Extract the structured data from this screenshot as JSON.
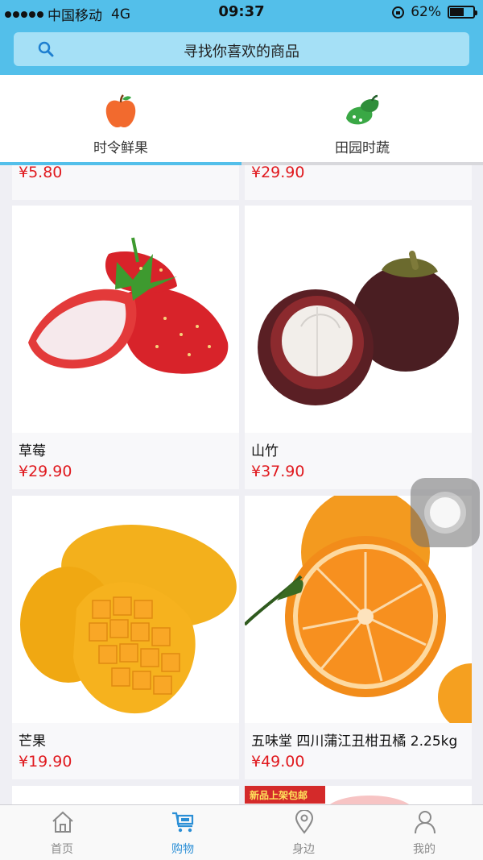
{
  "status_bar": {
    "carrier": "中国移动",
    "network": "4G",
    "time": "09:37",
    "battery": "62%",
    "battery_level": 0.62
  },
  "search": {
    "placeholder": "寻找你喜欢的商品",
    "icon": "search-icon"
  },
  "categories": [
    {
      "label": "时令鲜果",
      "icon": "apple-icon",
      "active": true
    },
    {
      "label": "田园时蔬",
      "icon": "vegetable-icon",
      "active": false
    }
  ],
  "products": [
    {
      "name": "",
      "price": "¥5.80"
    },
    {
      "name": "",
      "price": "¥29.90"
    },
    {
      "name": "草莓",
      "price": "¥29.90",
      "image": "strawberry"
    },
    {
      "name": "山竹",
      "price": "¥37.90",
      "image": "mangosteen"
    },
    {
      "name": "芒果",
      "price": "¥19.90",
      "image": "mango"
    },
    {
      "name": "五味堂  四川蒲江丑柑丑橘 2.25kg",
      "price": "¥49.00",
      "image": "orange"
    },
    {
      "name": "",
      "price": "",
      "image": "blank"
    },
    {
      "name": "",
      "price": "",
      "image": "peach",
      "badge": "新品上架包邮"
    }
  ],
  "bottom_nav": [
    {
      "label": "首页",
      "icon": "home-icon",
      "active": false
    },
    {
      "label": "购物",
      "icon": "cart-icon",
      "active": true
    },
    {
      "label": "身边",
      "icon": "location-pin-icon",
      "active": false
    },
    {
      "label": "我的",
      "icon": "user-icon",
      "active": false
    }
  ],
  "colors": {
    "header": "#53bfea",
    "search_bg": "#a5e0f6",
    "price": "#e0191e",
    "active_tab": "#2b8fd6"
  }
}
